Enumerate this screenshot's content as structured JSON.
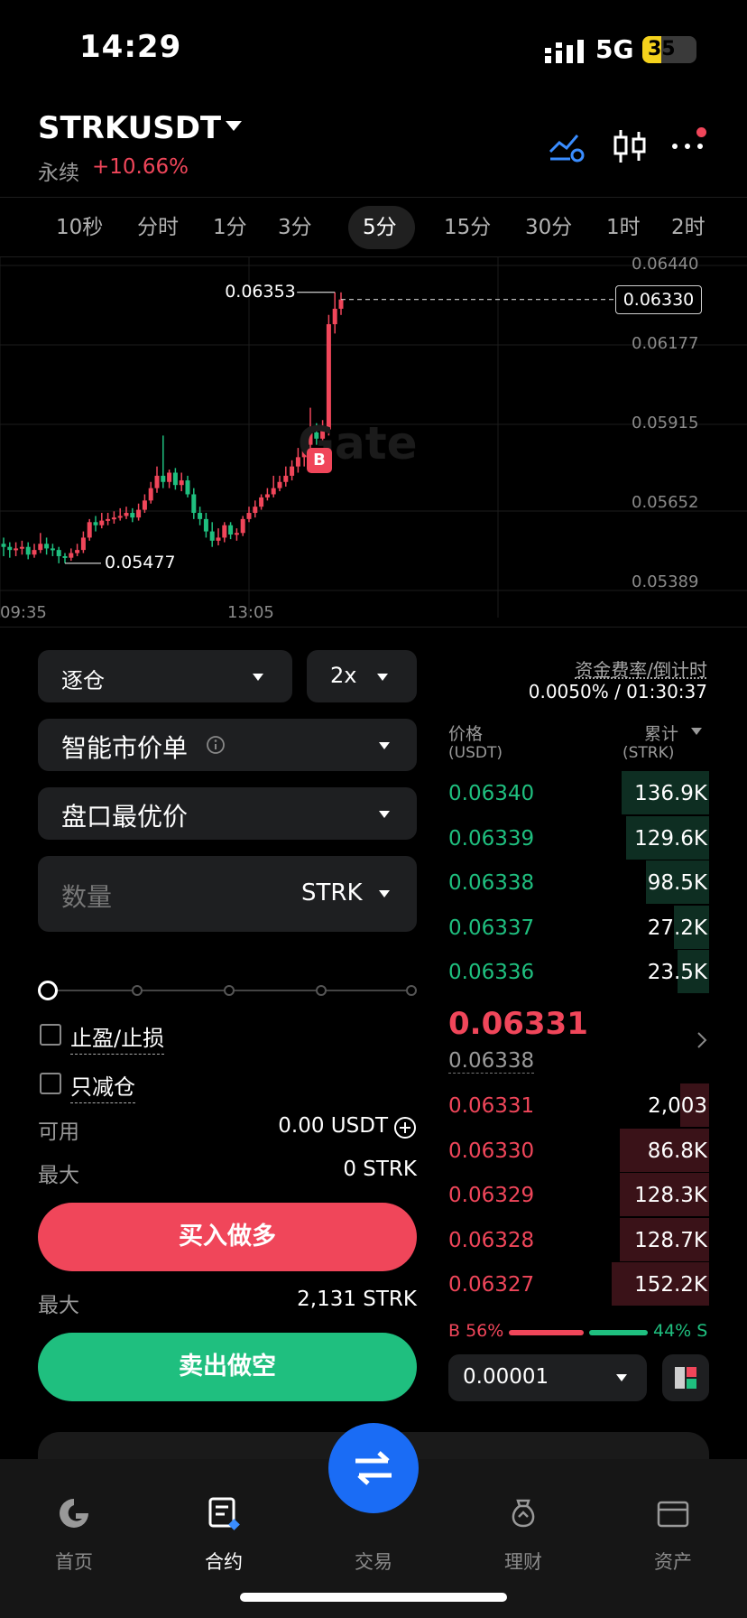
{
  "status_bar": {
    "time": "14:29",
    "network": "5G",
    "battery": "35",
    "battery_level": 0.35
  },
  "header": {
    "pair": "STRKUSDT",
    "contract_type": "永续",
    "change": "+10.66%"
  },
  "timeframes": [
    "10秒",
    "分时",
    "1分",
    "3分",
    "5分",
    "15分",
    "30分",
    "1时",
    "2时"
  ],
  "timeframe_active": "5分",
  "chart_data": {
    "type": "candlestick",
    "y_ticks": [
      "0.06440",
      "0.06177",
      "0.05915",
      "0.05652",
      "0.05389"
    ],
    "ylim": [
      0.05389,
      0.0644
    ],
    "x_ticks": [
      "09:35",
      "13:05"
    ],
    "high_label": "0.06353",
    "low_label": "0.05477",
    "last_price": "0.06330",
    "marker": "B",
    "watermark": "Gate",
    "candles": [
      {
        "o": 0.0554,
        "c": 0.0553,
        "h": 0.0556,
        "l": 0.055
      },
      {
        "o": 0.0553,
        "c": 0.0552,
        "h": 0.05545,
        "l": 0.05495
      },
      {
        "o": 0.0552,
        "c": 0.05525,
        "h": 0.05545,
        "l": 0.055
      },
      {
        "o": 0.05525,
        "c": 0.0553,
        "h": 0.0555,
        "l": 0.05505
      },
      {
        "o": 0.0553,
        "c": 0.05505,
        "h": 0.05545,
        "l": 0.0549
      },
      {
        "o": 0.05505,
        "c": 0.0552,
        "h": 0.0554,
        "l": 0.05495
      },
      {
        "o": 0.0552,
        "c": 0.0554,
        "h": 0.05575,
        "l": 0.0551
      },
      {
        "o": 0.0554,
        "c": 0.05525,
        "h": 0.0556,
        "l": 0.05505
      },
      {
        "o": 0.05525,
        "c": 0.0552,
        "h": 0.0554,
        "l": 0.055
      },
      {
        "o": 0.0552,
        "c": 0.055,
        "h": 0.0553,
        "l": 0.05477
      },
      {
        "o": 0.055,
        "c": 0.05495,
        "h": 0.0551,
        "l": 0.05477
      },
      {
        "o": 0.05495,
        "c": 0.0551,
        "h": 0.05525,
        "l": 0.05485
      },
      {
        "o": 0.0551,
        "c": 0.0552,
        "h": 0.0554,
        "l": 0.055
      },
      {
        "o": 0.0552,
        "c": 0.0556,
        "h": 0.0558,
        "l": 0.0551
      },
      {
        "o": 0.0556,
        "c": 0.0561,
        "h": 0.0562,
        "l": 0.0555
      },
      {
        "o": 0.0561,
        "c": 0.056,
        "h": 0.0563,
        "l": 0.0558
      },
      {
        "o": 0.056,
        "c": 0.05615,
        "h": 0.0564,
        "l": 0.0559
      },
      {
        "o": 0.05615,
        "c": 0.0562,
        "h": 0.0564,
        "l": 0.056
      },
      {
        "o": 0.0562,
        "c": 0.05625,
        "h": 0.05645,
        "l": 0.05605
      },
      {
        "o": 0.05625,
        "c": 0.0563,
        "h": 0.05655,
        "l": 0.05615
      },
      {
        "o": 0.0563,
        "c": 0.0564,
        "h": 0.0566,
        "l": 0.0562
      },
      {
        "o": 0.0564,
        "c": 0.05625,
        "h": 0.05655,
        "l": 0.0561
      },
      {
        "o": 0.05625,
        "c": 0.0565,
        "h": 0.0567,
        "l": 0.05615
      },
      {
        "o": 0.0565,
        "c": 0.0568,
        "h": 0.057,
        "l": 0.0564
      },
      {
        "o": 0.0568,
        "c": 0.0572,
        "h": 0.0574,
        "l": 0.0567
      },
      {
        "o": 0.0572,
        "c": 0.0576,
        "h": 0.0579,
        "l": 0.05705
      },
      {
        "o": 0.0576,
        "c": 0.0574,
        "h": 0.0589,
        "l": 0.0572
      },
      {
        "o": 0.0574,
        "c": 0.0577,
        "h": 0.0578,
        "l": 0.0572
      },
      {
        "o": 0.0577,
        "c": 0.0573,
        "h": 0.05785,
        "l": 0.05715
      },
      {
        "o": 0.0573,
        "c": 0.05745,
        "h": 0.0577,
        "l": 0.0571
      },
      {
        "o": 0.05745,
        "c": 0.057,
        "h": 0.0576,
        "l": 0.0569
      },
      {
        "o": 0.057,
        "c": 0.0564,
        "h": 0.0572,
        "l": 0.0562
      },
      {
        "o": 0.0564,
        "c": 0.0562,
        "h": 0.0566,
        "l": 0.056
      },
      {
        "o": 0.0562,
        "c": 0.0558,
        "h": 0.0564,
        "l": 0.0556
      },
      {
        "o": 0.0558,
        "c": 0.0555,
        "h": 0.0561,
        "l": 0.0553
      },
      {
        "o": 0.0555,
        "c": 0.0556,
        "h": 0.0559,
        "l": 0.05535
      },
      {
        "o": 0.0556,
        "c": 0.056,
        "h": 0.0561,
        "l": 0.05545
      },
      {
        "o": 0.056,
        "c": 0.0557,
        "h": 0.0561,
        "l": 0.05555
      },
      {
        "o": 0.0557,
        "c": 0.05575,
        "h": 0.0559,
        "l": 0.0555
      },
      {
        "o": 0.05575,
        "c": 0.0562,
        "h": 0.0563,
        "l": 0.05565
      },
      {
        "o": 0.0562,
        "c": 0.0564,
        "h": 0.0566,
        "l": 0.0561
      },
      {
        "o": 0.0564,
        "c": 0.0566,
        "h": 0.0568,
        "l": 0.05625
      },
      {
        "o": 0.0566,
        "c": 0.0569,
        "h": 0.057,
        "l": 0.0565
      },
      {
        "o": 0.0569,
        "c": 0.057,
        "h": 0.0572,
        "l": 0.0568
      },
      {
        "o": 0.057,
        "c": 0.0572,
        "h": 0.0576,
        "l": 0.0569
      },
      {
        "o": 0.0572,
        "c": 0.0574,
        "h": 0.0576,
        "l": 0.0571
      },
      {
        "o": 0.0574,
        "c": 0.0576,
        "h": 0.0579,
        "l": 0.05725
      },
      {
        "o": 0.0576,
        "c": 0.0579,
        "h": 0.0581,
        "l": 0.05745
      },
      {
        "o": 0.0579,
        "c": 0.0582,
        "h": 0.0585,
        "l": 0.0577
      },
      {
        "o": 0.0582,
        "c": 0.0586,
        "h": 0.0588,
        "l": 0.0579
      },
      {
        "o": 0.0586,
        "c": 0.059,
        "h": 0.0598,
        "l": 0.0584
      },
      {
        "o": 0.059,
        "c": 0.0588,
        "h": 0.0593,
        "l": 0.0586
      },
      {
        "o": 0.0588,
        "c": 0.0591,
        "h": 0.0594,
        "l": 0.0586
      },
      {
        "o": 0.0591,
        "c": 0.0625,
        "h": 0.0628,
        "l": 0.0589
      },
      {
        "o": 0.0625,
        "c": 0.063,
        "h": 0.06353,
        "l": 0.0622
      },
      {
        "o": 0.063,
        "c": 0.0633,
        "h": 0.06353,
        "l": 0.0628
      }
    ]
  },
  "order_form": {
    "margin_mode": "逐仓",
    "leverage": "2x",
    "order_type": "智能市价单",
    "price_mode": "盘口最优价",
    "quantity_placeholder": "数量",
    "quantity_unit": "STRK",
    "tp_sl": "止盈/止损",
    "reduce_only": "只减仓",
    "available_label": "可用",
    "available_value": "0.00 USDT",
    "max_label": "最大",
    "max_buy": "0 STRK",
    "buy_label": "买入做多",
    "max_sell": "2,131 STRK",
    "sell_label": "卖出做空"
  },
  "funding": {
    "label": "资金费率/倒计时",
    "value": "0.0050% / 01:30:37"
  },
  "orderbook": {
    "price_header": "价格",
    "price_unit": "(USDT)",
    "qty_header": "累计",
    "qty_unit": "(STRK)",
    "asks": [
      {
        "price": "0.06340",
        "qty": "136.9K",
        "depth": 0.9
      },
      {
        "price": "0.06339",
        "qty": "129.6K",
        "depth": 0.85
      },
      {
        "price": "0.06338",
        "qty": "98.5K",
        "depth": 0.65
      },
      {
        "price": "0.06337",
        "qty": "27.2K",
        "depth": 0.36
      },
      {
        "price": "0.06336",
        "qty": "23.5K",
        "depth": 0.32
      }
    ],
    "last_price": "0.06331",
    "mark_price": "0.06338",
    "bids": [
      {
        "price": "0.06331",
        "qty": "2,003",
        "depth": 0.3
      },
      {
        "price": "0.06330",
        "qty": "86.8K",
        "depth": 0.92
      },
      {
        "price": "0.06329",
        "qty": "128.3K",
        "depth": 0.92
      },
      {
        "price": "0.06328",
        "qty": "128.7K",
        "depth": 0.92
      },
      {
        "price": "0.06327",
        "qty": "152.2K",
        "depth": 1.0
      }
    ],
    "buy_ratio_label": "B 56%",
    "sell_ratio_label": "44% S",
    "buy_ratio": 56,
    "precision": "0.00001"
  },
  "tabbar": {
    "items": [
      "首页",
      "合约",
      "交易",
      "理财",
      "资产"
    ],
    "active": "合约"
  },
  "colors": {
    "up": "#1fbf7f",
    "down": "#f0465a",
    "accent": "#1a6cf5"
  }
}
